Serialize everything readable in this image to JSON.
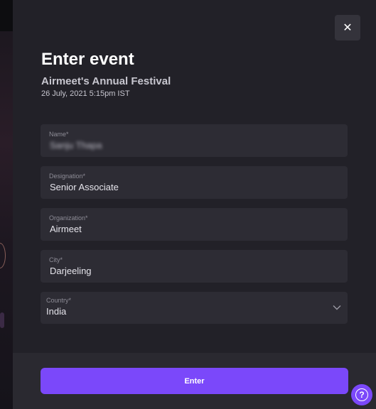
{
  "dialog": {
    "title": "Enter event",
    "event_name": "Airmeet's Annual Festival",
    "event_date": "26 July, 2021 5:15pm IST",
    "close_icon": "close-icon",
    "close_glyph": "✕"
  },
  "fields": {
    "name": {
      "label": "Name*",
      "value": "Sanju Thapa"
    },
    "designation": {
      "label": "Designation*",
      "value": "Senior Associate"
    },
    "organization": {
      "label": "Organization*",
      "value": "Airmeet"
    },
    "city": {
      "label": "City*",
      "value": "Darjeeling"
    },
    "country": {
      "label": "Country*",
      "value": "India"
    }
  },
  "footer": {
    "enter_label": "Enter"
  },
  "help": {
    "icon": "help-icon",
    "glyph": "?"
  },
  "colors": {
    "accent": "#7b48fa",
    "panel": "#222128",
    "field": "#2d2c34",
    "footer": "#2a2930"
  }
}
